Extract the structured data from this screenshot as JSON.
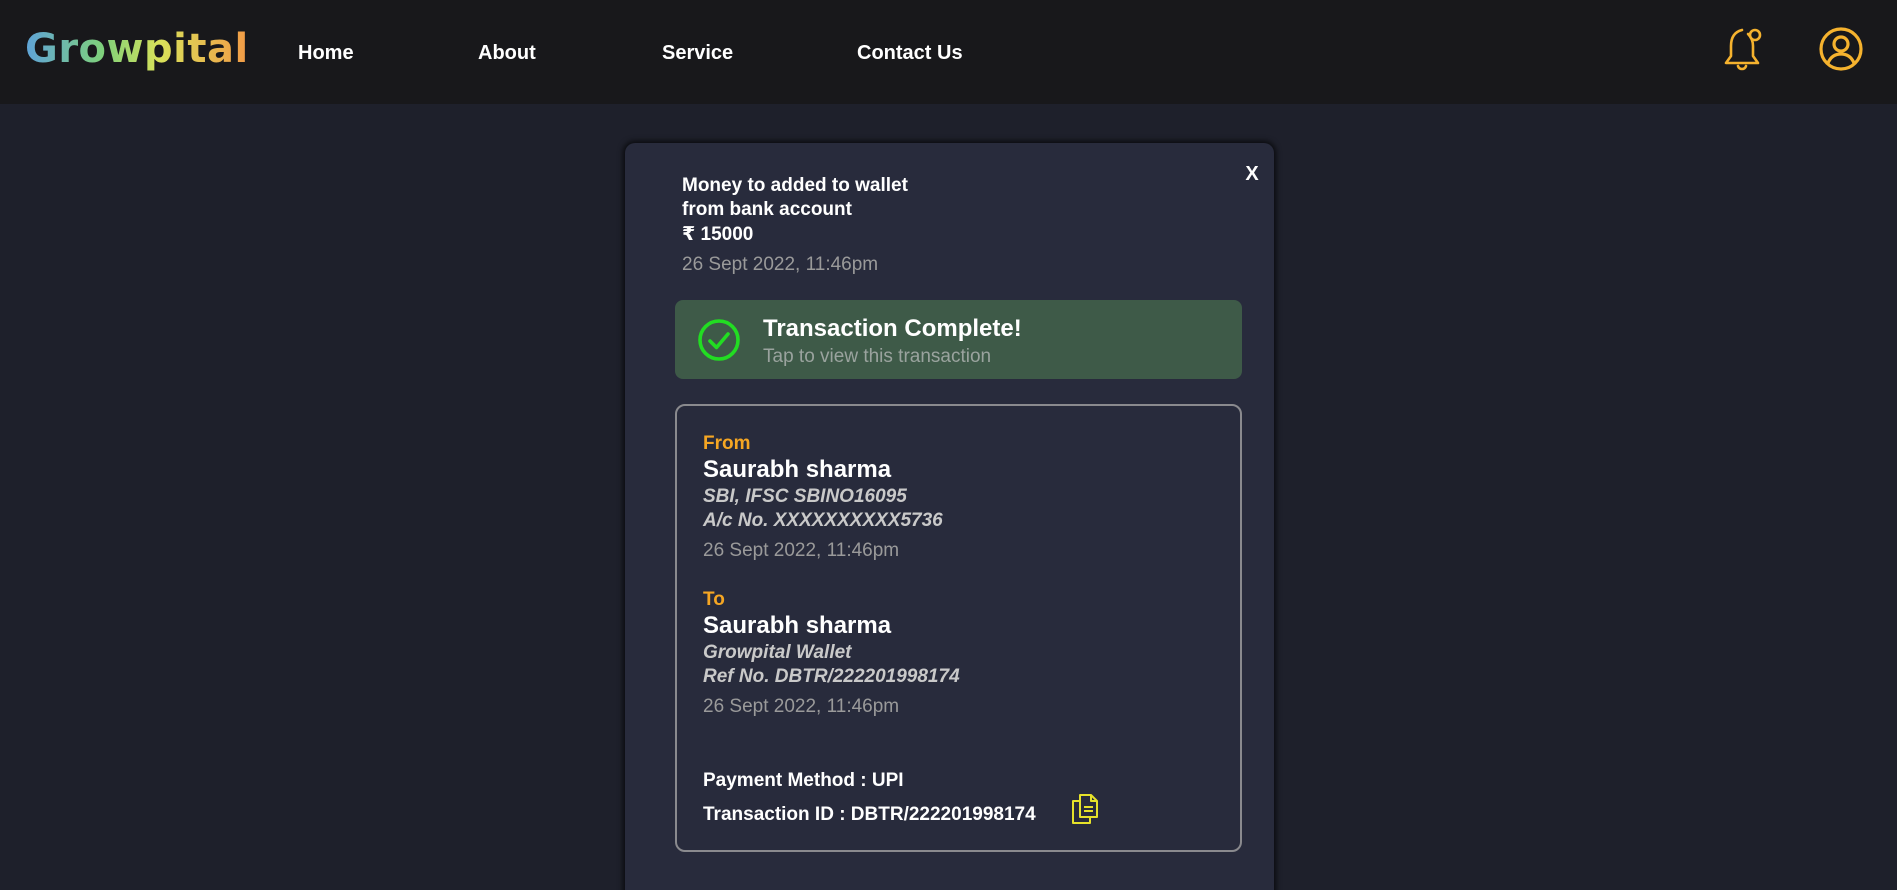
{
  "nav": {
    "logo": "Growpital",
    "links": [
      "Home",
      "About",
      "Service",
      "Contact Us"
    ],
    "icons": [
      "bell-icon",
      "user-circle-icon"
    ],
    "accent": "#f5b22e"
  },
  "modal": {
    "close_label": "X",
    "header": {
      "line1": "Money to added to wallet",
      "line2": "from bank account",
      "amount": "₹ 15000",
      "date": "26 Sept 2022, 11:46pm"
    },
    "status": {
      "title": "Transaction Complete!",
      "subtitle": "Tap to view this transaction",
      "icon": "check-circle-icon",
      "color": "#22dd22"
    },
    "from": {
      "label": "From",
      "name": "Saurabh sharma",
      "line1": "SBI, IFSC SBINO16095",
      "line2": "A/c No. XXXXXXXXXX5736",
      "date": "26 Sept 2022, 11:46pm"
    },
    "to": {
      "label": "To",
      "name": "Saurabh sharma",
      "line1": "Growpital Wallet",
      "line2": "Ref No. DBTR/222201998174",
      "date": "26 Sept 2022, 11:46pm"
    },
    "payment_method": "Payment Method : UPI",
    "transaction_id": "Transaction ID : DBTR/222201998174",
    "copy_icon": "copy-icon"
  }
}
